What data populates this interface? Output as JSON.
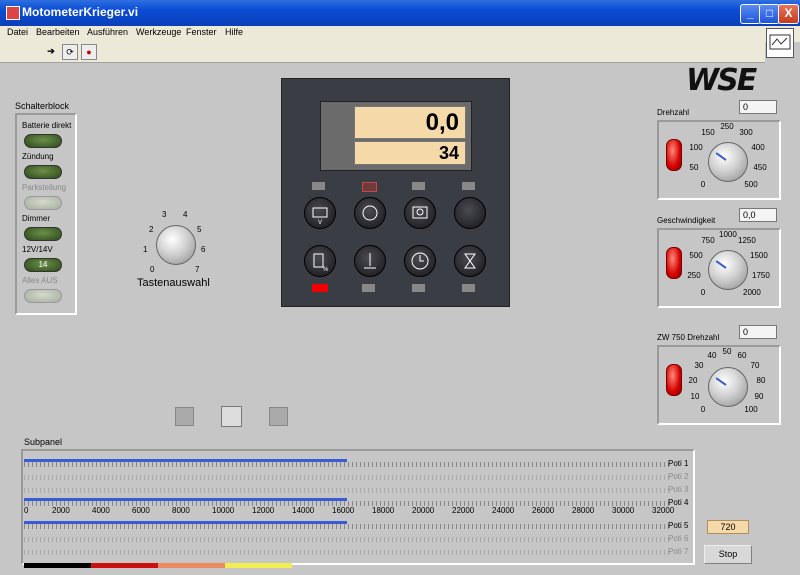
{
  "window": {
    "title": "MotometerKrieger.vi",
    "min": "_",
    "max": "□",
    "close": "X"
  },
  "menu": [
    "Datei",
    "Bearbeiten",
    "Ausführen",
    "Werkzeuge",
    "Fenster",
    "Hilfe"
  ],
  "toolbar": {
    "run": "➔",
    "run_cont": "⟳",
    "abort": "●"
  },
  "logo": "WSE",
  "switch_block": {
    "title": "Schalterblock",
    "items": [
      {
        "label": "Batterie direkt",
        "enabled": true,
        "text": ""
      },
      {
        "label": "Zündung",
        "enabled": true,
        "text": ""
      },
      {
        "label": "Parkstellung",
        "enabled": false,
        "text": ""
      },
      {
        "label": "Dimmer",
        "enabled": true,
        "text": ""
      },
      {
        "label": "12V/14V",
        "enabled": true,
        "text": "14"
      },
      {
        "label": "Alles AUS",
        "enabled": false,
        "text": ""
      }
    ]
  },
  "selector_knob": {
    "label": "Tastenauswahl",
    "ticks": [
      "0",
      "1",
      "2",
      "3",
      "4",
      "5",
      "6",
      "7"
    ]
  },
  "display": {
    "value1": "0,0",
    "value2": "34"
  },
  "gauges": [
    {
      "label": "Drehzahl",
      "value": "0",
      "ticks": [
        "0",
        "50",
        "100",
        "150",
        "250",
        "300",
        "400",
        "450",
        "500"
      ]
    },
    {
      "label": "Geschwindigkeit",
      "value": "0,0",
      "ticks": [
        "0",
        "250",
        "500",
        "750",
        "1000",
        "1250",
        "1500",
        "1750",
        "2000"
      ]
    },
    {
      "label": "ZW 750 Drehzahl",
      "value": "0",
      "ticks": [
        "0",
        "10",
        "20",
        "30",
        "40",
        "50",
        "60",
        "70",
        "80",
        "90",
        "100"
      ]
    }
  ],
  "subpanel": {
    "title": "Subpanel",
    "scale": [
      "0",
      "2000",
      "4000",
      "6000",
      "8000",
      "10000",
      "12000",
      "14000",
      "16000",
      "18000",
      "20000",
      "22000",
      "24000",
      "26000",
      "28000",
      "30000",
      "32000"
    ],
    "sliders": [
      {
        "label": "Poti 1",
        "fraction": 0.5,
        "enabled": true
      },
      {
        "label": "Poti 2",
        "fraction": 0,
        "enabled": false
      },
      {
        "label": "Poti 3",
        "fraction": 0,
        "enabled": false
      },
      {
        "label": "Poti 4",
        "fraction": 0.5,
        "enabled": true
      },
      {
        "label": "Poti 5",
        "fraction": 0.5,
        "enabled": true
      },
      {
        "label": "Poti 6",
        "fraction": 0,
        "enabled": false
      },
      {
        "label": "Poti 7",
        "fraction": 0,
        "enabled": false
      }
    ]
  },
  "counter": {
    "value": "720"
  },
  "stop_button": "Stop",
  "colors": {
    "accent": "#3a5bd6",
    "lcd": "#f6d9a8",
    "led": "#d40000",
    "bar": [
      "#000000",
      "#cc1010",
      "#e98a60",
      "#f0ee50"
    ]
  }
}
